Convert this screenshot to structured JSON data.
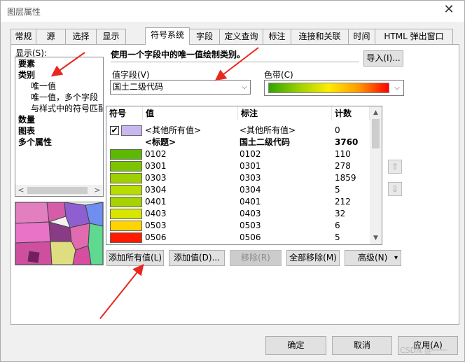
{
  "window": {
    "title": "图层属性",
    "close_glyph": "✕"
  },
  "tabs": [
    "常规",
    "源",
    "选择",
    "显示",
    "符号系统",
    "字段",
    "定义查询",
    "标注",
    "连接和关联",
    "时间",
    "HTML 弹出窗口"
  ],
  "show_label": "显示(S):",
  "tree": {
    "items": [
      {
        "label": "要素",
        "bold": true
      },
      {
        "label": "类别",
        "bold": true
      },
      {
        "label": "唯一值",
        "bold": false
      },
      {
        "label": "唯一值，多个字段",
        "bold": false
      },
      {
        "label": "与样式中的符号匹配",
        "bold": false
      },
      {
        "label": "数量",
        "bold": true
      },
      {
        "label": "图表",
        "bold": true
      },
      {
        "label": "多个属性",
        "bold": true
      }
    ],
    "scroll_left": "<",
    "scroll_right": ">"
  },
  "description": "使用一个字段中的唯一值绘制类别。",
  "import_button": "导入(I)...",
  "value_field": {
    "label": "值字段(V)",
    "value": "国土二级代码",
    "chevron": "⌵"
  },
  "color_ramp": {
    "label": "色带(C)",
    "chevron": "⌵"
  },
  "table": {
    "headers": {
      "symbol": "符号",
      "value": "值",
      "label": "标注",
      "count": "计数"
    },
    "other_row": {
      "checked": "✔",
      "value": "<其他所有值>",
      "label": "<其他所有值>",
      "count": "0",
      "color": "#c9b8f0"
    },
    "heading_row": {
      "value": "<标题>",
      "label": "国土二级代码",
      "count": "3760"
    },
    "rows": [
      {
        "value": "0102",
        "label": "0102",
        "count": "110",
        "color": "#5cb800"
      },
      {
        "value": "0301",
        "label": "0301",
        "count": "278",
        "color": "#7cc400"
      },
      {
        "value": "0303",
        "label": "0303",
        "count": "1859",
        "color": "#9fd000"
      },
      {
        "value": "0304",
        "label": "0304",
        "count": "5",
        "color": "#b9dc00"
      },
      {
        "value": "0401",
        "label": "0401",
        "count": "212",
        "color": "#a5d200"
      },
      {
        "value": "0403",
        "label": "0403",
        "count": "32",
        "color": "#d8e600"
      },
      {
        "value": "0503",
        "label": "0503",
        "count": "6",
        "color": "#ffd400"
      },
      {
        "value": "0506",
        "label": "0506",
        "count": "5",
        "color": "#ff1a00"
      }
    ],
    "scroll_up": "▲",
    "scroll_down": "▼"
  },
  "side_buttons": {
    "up": "⇧",
    "down": "⇩"
  },
  "action_buttons": {
    "add_all": "添加所有值(L)",
    "add_values": "添加值(D)...",
    "remove": "移除(R)",
    "remove_all": "全部移除(M)",
    "advanced": "高级(N)",
    "advanced_arrow": "▾"
  },
  "footer": {
    "ok": "确定",
    "cancel": "取消",
    "apply": "应用(A)"
  },
  "watermark": "CSDN @一一",
  "colors": {
    "annotation_arrow": "#e8271f",
    "window_bg": "#f0f0f0"
  }
}
